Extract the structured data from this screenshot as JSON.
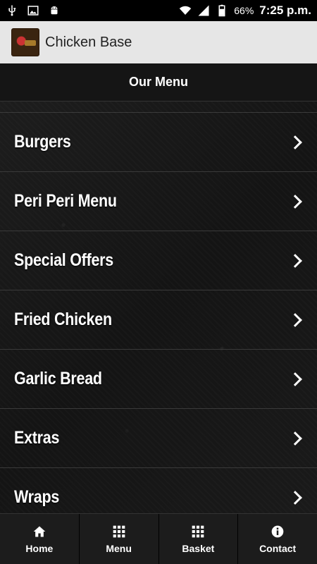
{
  "status_bar": {
    "battery": "66%",
    "time": "7:25 p.m."
  },
  "app_bar": {
    "title": "Chicken Base"
  },
  "header": {
    "title": "Our Menu"
  },
  "menu": {
    "items": [
      {
        "label": "Burgers"
      },
      {
        "label": "Peri Peri Menu"
      },
      {
        "label": "Special Offers"
      },
      {
        "label": "Fried Chicken"
      },
      {
        "label": "Garlic Bread"
      },
      {
        "label": "Extras"
      },
      {
        "label": "Wraps"
      }
    ]
  },
  "bottom_nav": {
    "items": [
      {
        "label": "Home",
        "icon": "home-icon"
      },
      {
        "label": "Menu",
        "icon": "grid-icon"
      },
      {
        "label": "Basket",
        "icon": "grid-icon"
      },
      {
        "label": "Contact",
        "icon": "info-icon"
      }
    ]
  }
}
